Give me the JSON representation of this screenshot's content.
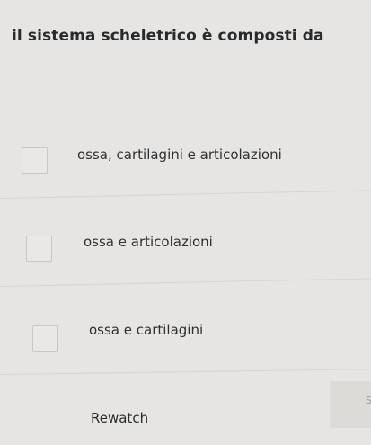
{
  "question": {
    "text": "il sistema scheletrico è composti da"
  },
  "options": [
    {
      "label": "ossa, cartilagini e articolazioni",
      "checked": false
    },
    {
      "label": "ossa e articolazioni",
      "checked": false
    },
    {
      "label": "ossa e cartilagini",
      "checked": false
    }
  ],
  "footer": {
    "rewatch_label": "Rewatch",
    "corner_glyph": "S"
  }
}
